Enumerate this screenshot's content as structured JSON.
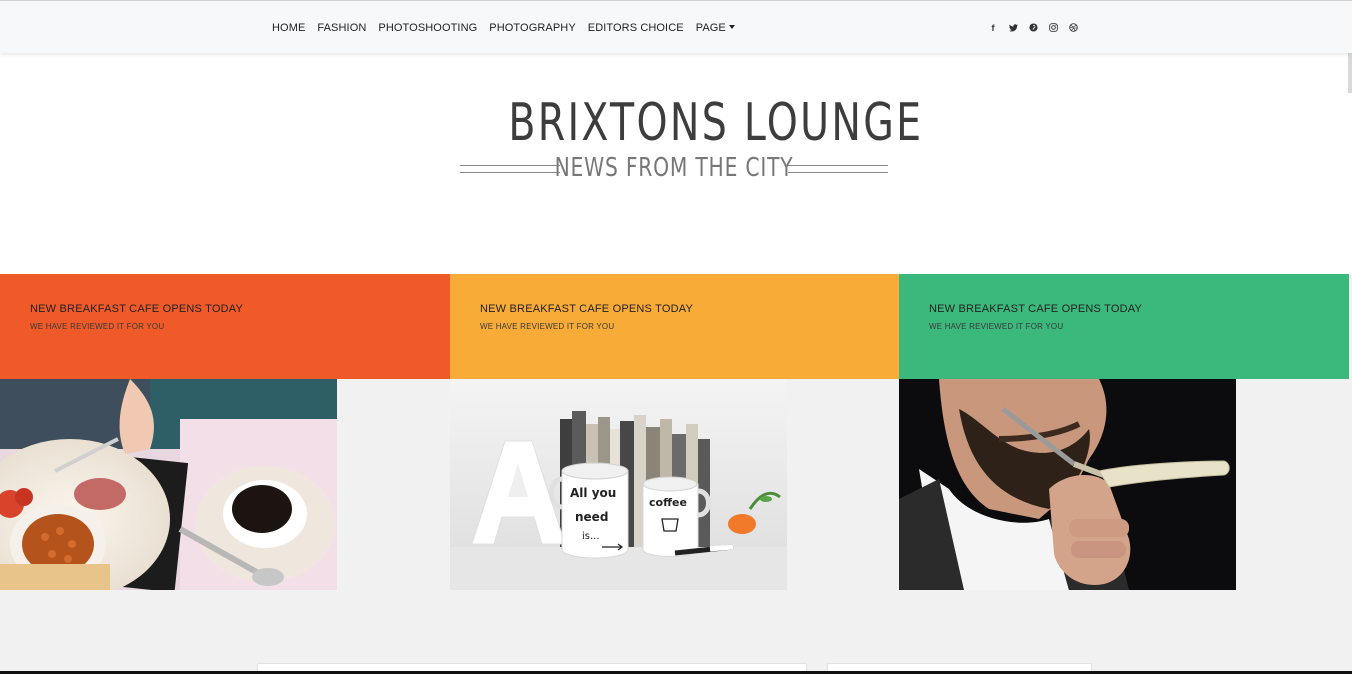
{
  "nav": {
    "items": [
      "HOME",
      "FASHION",
      "PHOTOSHOOTING",
      "PHOTOGRAPHY",
      "EDITORS CHOICE",
      "PAGE"
    ]
  },
  "social": [
    {
      "icon": "facebook-icon",
      "glyph": "f"
    },
    {
      "icon": "twitter-icon",
      "glyph": "t"
    },
    {
      "icon": "pinterest-icon",
      "glyph": "p"
    },
    {
      "icon": "instagram-icon",
      "glyph": "◎"
    },
    {
      "icon": "dribbble-icon",
      "glyph": "✺"
    }
  ],
  "logo": {
    "title": "BRIXTONS LOUNGE",
    "subtitle": "NEWS FROM THE CITY"
  },
  "cards": [
    {
      "title": "NEW BREAKFAST CAFE OPENS TODAY",
      "subtitle": "WE HAVE REVIEWED IT FOR YOU",
      "color": "#f05a28",
      "image": "breakfast-photo"
    },
    {
      "title": "NEW BREAKFAST CAFE OPENS TODAY",
      "subtitle": "WE HAVE REVIEWED IT FOR YOU",
      "color": "#f9ab38",
      "image": "coffee-mugs-photo"
    },
    {
      "title": "NEW BREAKFAST CAFE OPENS TODAY",
      "subtitle": "WE HAVE REVIEWED IT FOR YOU",
      "color": "#3bb87b",
      "image": "beard-shave-photo"
    }
  ],
  "images": {
    "mug_left_text": "All you need is...",
    "mug_right_text": "coffee"
  }
}
